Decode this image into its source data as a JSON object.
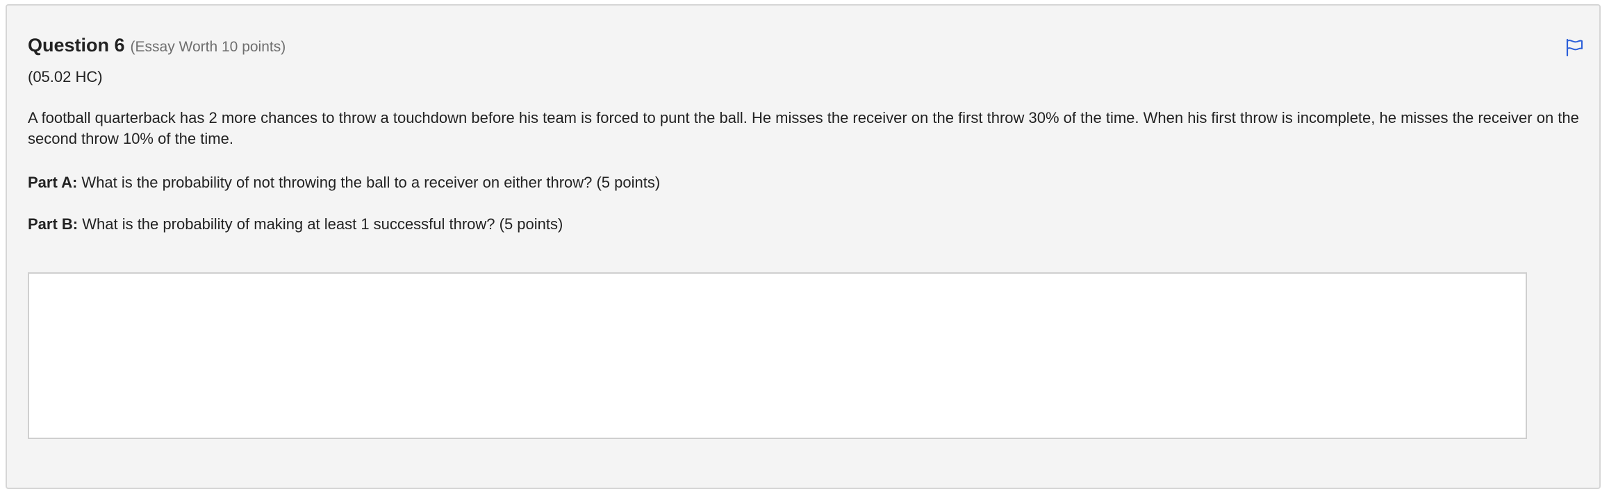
{
  "question": {
    "title": "Question 6",
    "worth": "(Essay Worth 10 points)",
    "code": "(05.02 HC)",
    "body": "A football quarterback has 2 more chances to throw a touchdown before his team is forced to punt the ball. He misses the receiver on the first throw 30% of the time. When his first throw is incomplete, he misses the receiver on the second throw 10% of the time.",
    "part_a_label": "Part A:",
    "part_a_text": " What is the probability of not throwing the ball to a receiver on either throw? (5 points)",
    "part_b_label": "Part B:",
    "part_b_text": " What is the probability of making at least 1 successful throw? (5 points)"
  },
  "answer": {
    "value": ""
  },
  "icons": {
    "flag": "flag-icon"
  },
  "colors": {
    "flag": "#2b5fd9",
    "card_bg": "#f4f4f4",
    "muted_text": "#6e6e6e"
  }
}
